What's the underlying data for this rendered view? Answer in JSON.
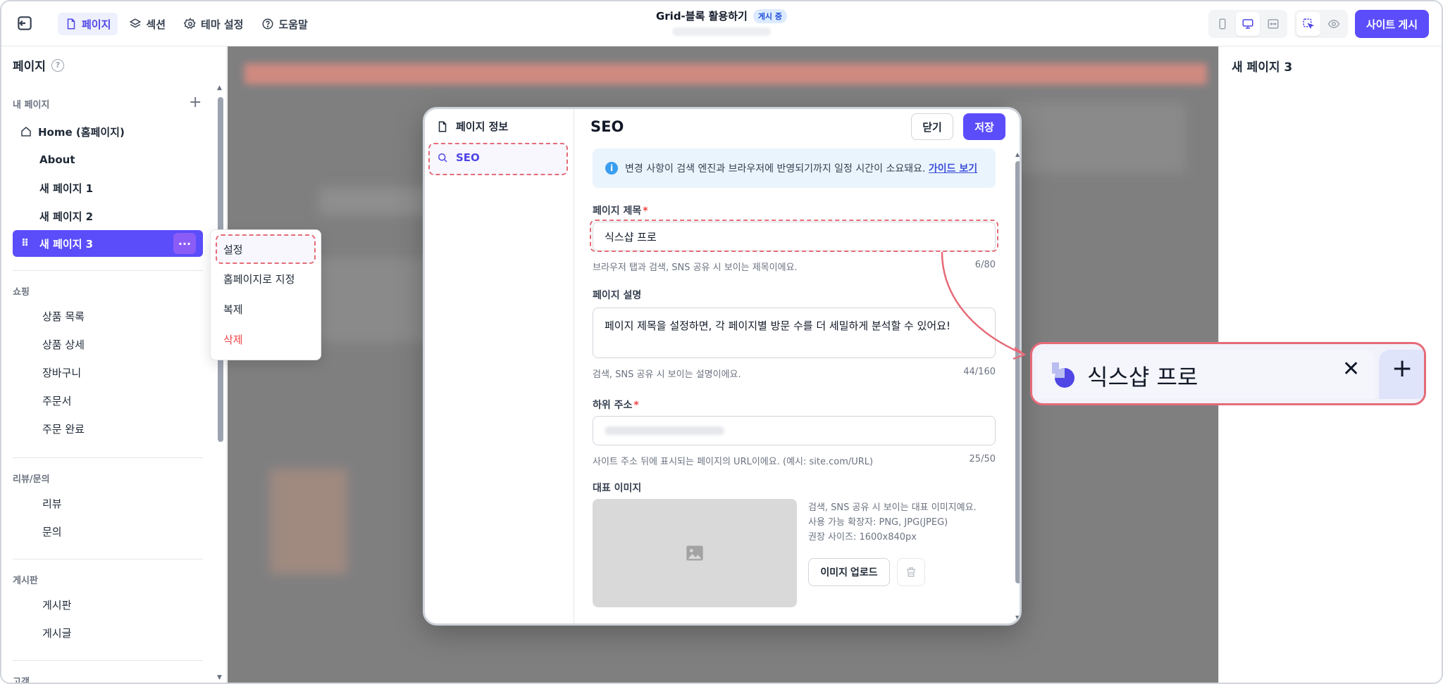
{
  "topbar": {
    "menu": [
      {
        "label": "페이지",
        "icon": "page-icon",
        "active": true
      },
      {
        "label": "섹션",
        "icon": "layers-icon"
      },
      {
        "label": "테마 설정",
        "icon": "gear-icon"
      },
      {
        "label": "도움말",
        "icon": "help-icon"
      }
    ],
    "title": "Grid-블록 활용하기",
    "status_badge": "게시 중",
    "publish_label": "사이트 게시"
  },
  "sidebar": {
    "title": "페이지",
    "help": "?",
    "sections": {
      "my_pages": "내 페이지",
      "shopping": "쇼핑",
      "review": "리뷰/문의",
      "board": "게시판",
      "customer": "고객"
    },
    "my_pages": [
      {
        "label": "Home (홈페이지)"
      },
      {
        "label": "About"
      },
      {
        "label": "새 페이지 1"
      },
      {
        "label": "새 페이지 2"
      },
      {
        "label": "새 페이지 3"
      }
    ],
    "shopping": [
      "상품 목록",
      "상품 상세",
      "장바구니",
      "주문서",
      "주문 완료"
    ],
    "review": [
      "리뷰",
      "문의"
    ],
    "board": [
      "게시판",
      "게시글"
    ],
    "more_label": "···",
    "drag_label": "⠿"
  },
  "context_menu": {
    "items": [
      "설정",
      "홈페이지로 지정",
      "복제",
      "삭제"
    ]
  },
  "right_panel": {
    "title": "새 페이지 3"
  },
  "modal": {
    "nav": [
      {
        "label": "페이지 정보",
        "icon": "document-icon"
      },
      {
        "label": "SEO",
        "icon": "search-icon"
      }
    ],
    "title": "SEO",
    "close_label": "닫기",
    "save_label": "저장",
    "info_text": "변경 사항이 검색 엔진과 브라우저에 반영되기까지 일정 시간이 소요돼요.",
    "info_link": "가이드 보기",
    "info_icon": "i",
    "page_title": {
      "label": "페이지 제목",
      "required": "*",
      "value": "식스샵 프로",
      "helper": "브라우저 탭과 검색, SNS 공유 시 보이는 제목이에요.",
      "count": "6/80"
    },
    "page_desc": {
      "label": "페이지 설명",
      "value": "페이지 제목을 설정하면, 각 페이지별 방문 수를 더 세밀하게 분석할 수 있어요!",
      "helper": "검색, SNS 공유 시 보이는 설명이에요.",
      "count": "44/160"
    },
    "slug": {
      "label": "하위 주소",
      "required": "*",
      "helper": "사이트 주소 뒤에 표시되는 페이지의 URL이에요. (예시: site.com/URL)",
      "count": "25/50"
    },
    "image": {
      "label": "대표 이미지",
      "info": [
        "검색, SNS 공유 시 보이는 대표 이미지예요.",
        "사용 가능 확장자: PNG, JPG(JPEG)",
        "권장 사이즈: 1600x840px"
      ],
      "upload_label": "이미지 업로드"
    }
  },
  "callout": {
    "tab_title": "식스샵 프로",
    "close_glyph": "✕",
    "new_tab_glyph": "+"
  },
  "colors": {
    "accent": "#5b4dfa",
    "highlight": "#e56b78",
    "danger": "#ef4444",
    "info_bg": "#eaf4fd"
  }
}
